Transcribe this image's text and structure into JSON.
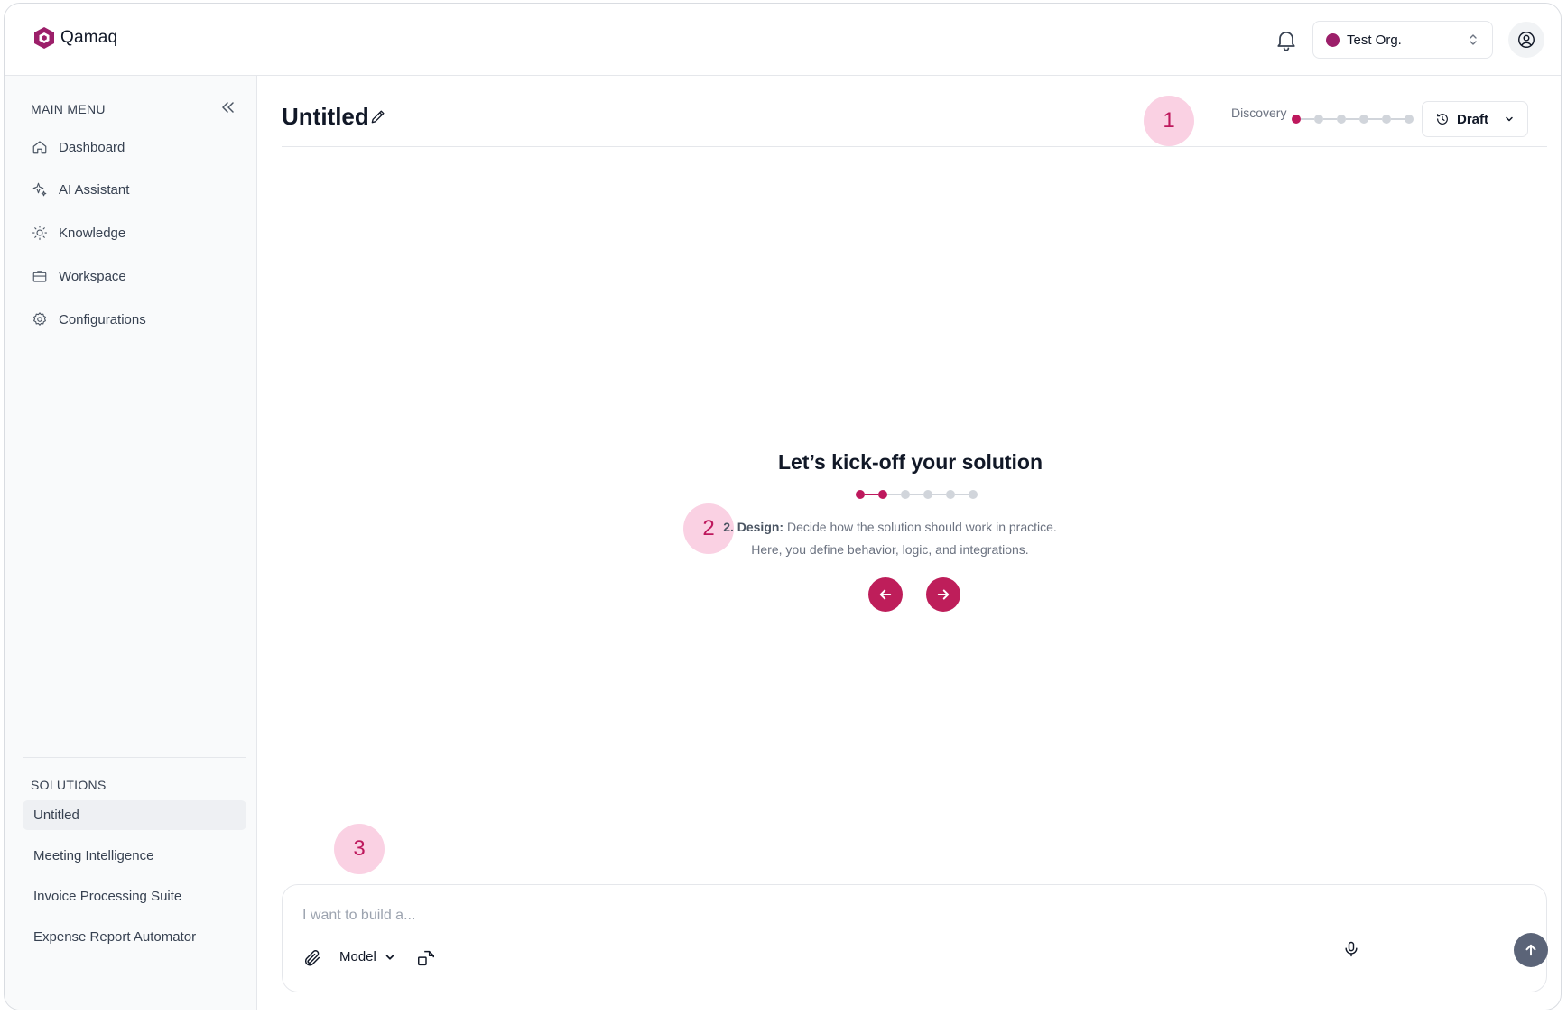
{
  "app": {
    "name": "Qamaq",
    "brand_color": "#be185d"
  },
  "header": {
    "org": {
      "name": "Test Org.",
      "dot_color": "#9c1f6a"
    },
    "icons": [
      "logo-icon",
      "bell-icon",
      "chevron-updown-icon",
      "user-circle-icon"
    ]
  },
  "sidebar": {
    "main_menu_label": "MAIN MENU",
    "items": [
      {
        "label": "Dashboard",
        "icon": "home-icon"
      },
      {
        "label": "AI Assistant",
        "icon": "sparkles-icon"
      },
      {
        "label": "Knowledge",
        "icon": "lightbulb-icon"
      },
      {
        "label": "Workspace",
        "icon": "briefcase-icon"
      },
      {
        "label": "Configurations",
        "icon": "gear-icon"
      }
    ],
    "solutions_label": "SOLUTIONS",
    "solutions": [
      {
        "label": "Untitled",
        "active": true
      },
      {
        "label": "Meeting Intelligence"
      },
      {
        "label": "Invoice Processing Suite"
      },
      {
        "label": "Expense Report Automator"
      }
    ]
  },
  "main": {
    "title": "Untitled",
    "stage": "Discovery",
    "stage_progress": {
      "current": 1,
      "total": 6
    },
    "status": "Draft",
    "badges": [
      "1",
      "2",
      "3"
    ],
    "hero": {
      "title": "Let’s kick-off your solution",
      "step_progress": {
        "current": 2,
        "total": 6
      },
      "step_label": "2. Design:",
      "step_text": " Decide how the solution should work in practice.",
      "step_text_2": "Here, you define behavior, logic, and integrations."
    },
    "composer": {
      "placeholder": "I want to build a...",
      "model_label": "Model"
    }
  }
}
